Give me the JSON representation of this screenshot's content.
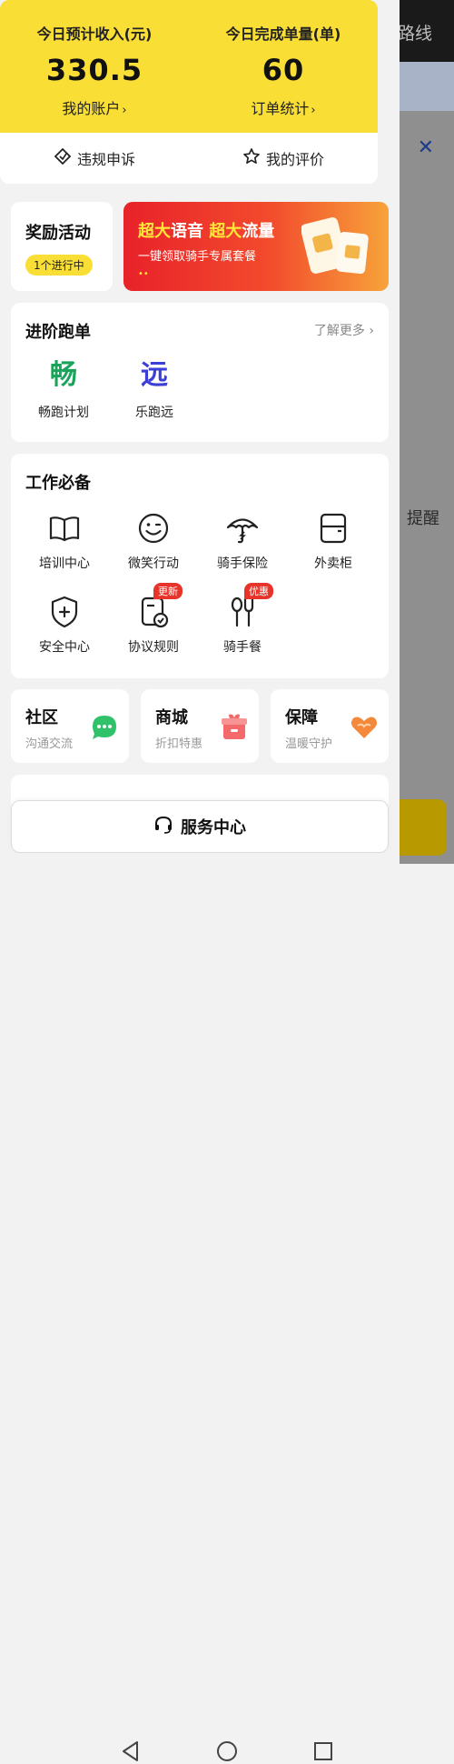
{
  "background": {
    "topbar_text": "路线",
    "close_symbol": "✕",
    "remind_text": "提醒"
  },
  "income": {
    "left": {
      "label": "今日预计收入(元)",
      "value": "330.5",
      "link": "我的账户"
    },
    "right": {
      "label": "今日完成单量(单)",
      "value": "60",
      "link": "订单统计"
    },
    "actions": [
      {
        "label": "违规申诉",
        "icon": "appeal-diamond-icon"
      },
      {
        "label": "我的评价",
        "icon": "star-outline-icon"
      }
    ]
  },
  "reward": {
    "title": "奖励活动",
    "badge": "1个进行中"
  },
  "promo": {
    "title_hl1": "超大",
    "title_part1": "语音 ",
    "title_hl2": "超大",
    "title_part2": "流量",
    "subtitle": "一键领取骑手专属套餐",
    "dots": "••",
    "icon": "sim-card-icon"
  },
  "advance": {
    "title": "进阶跑单",
    "more": "了解更多",
    "items": [
      {
        "glyph": "畅",
        "label": "畅跑计划",
        "color": "#1aa35a"
      },
      {
        "glyph": "远",
        "label": "乐跑远",
        "color": "#3b3fd6"
      }
    ]
  },
  "work": {
    "title": "工作必备",
    "tools": [
      {
        "label": "培训中心",
        "icon": "book-icon"
      },
      {
        "label": "微笑行动",
        "icon": "smile-icon"
      },
      {
        "label": "骑手保险",
        "icon": "umbrella-icon"
      },
      {
        "label": "外卖柜",
        "icon": "locker-icon"
      },
      {
        "label": "安全中心",
        "icon": "shield-icon"
      },
      {
        "label": "协议规则",
        "icon": "document-check-icon",
        "tag": "更新"
      },
      {
        "label": "骑手餐",
        "icon": "utensils-icon",
        "tag": "优惠"
      }
    ]
  },
  "mini": [
    {
      "title": "社区",
      "subtitle": "沟通交流",
      "icon": "chat-bubble-icon",
      "color": "#2fc26a"
    },
    {
      "title": "商城",
      "subtitle": "折扣特惠",
      "icon": "gift-box-icon",
      "color": "#f46a6a"
    },
    {
      "title": "保障",
      "subtitle": "温暖守护",
      "icon": "heart-hands-icon",
      "color": "#f5893b"
    }
  ],
  "service": {
    "label": "服务中心",
    "icon": "headset-icon"
  },
  "nav": {
    "back": "back-triangle-icon",
    "home": "home-circle-icon",
    "recent": "recent-square-icon"
  }
}
